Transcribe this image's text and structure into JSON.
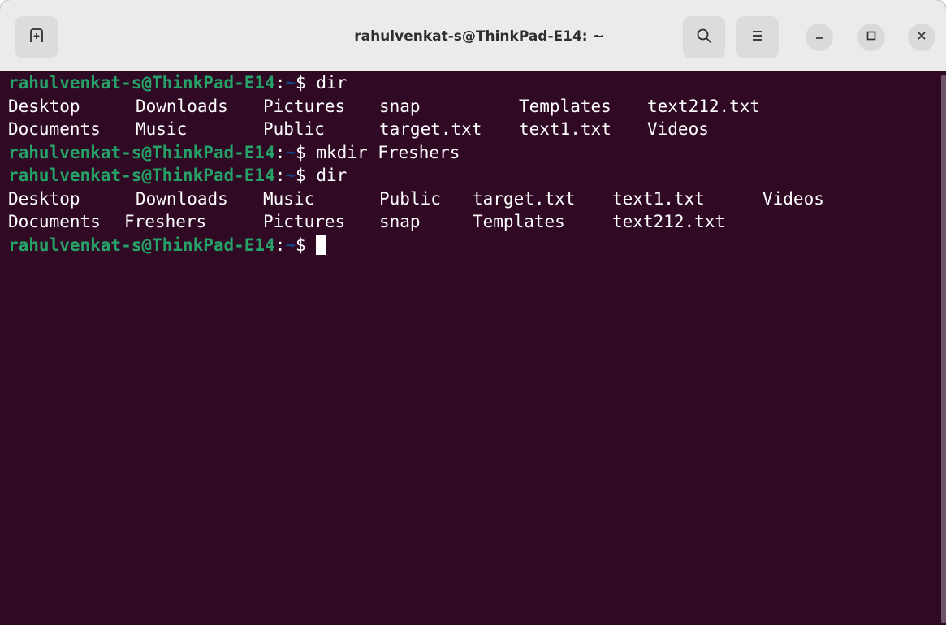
{
  "window": {
    "title": "rahulvenkat-s@ThinkPad-E14: ~"
  },
  "icons": {
    "new_tab": "new-tab-icon",
    "search": "search-icon",
    "menu": "hamburger-menu-icon",
    "minimize": "minimize-icon",
    "maximize": "maximize-icon",
    "close": "close-icon"
  },
  "colors": {
    "terminal_bg": "#300a24",
    "prompt_user": "#26a269",
    "prompt_path": "#12488b",
    "text": "#ffffff",
    "headerbar": "#ebebeb"
  },
  "prompt": {
    "user": "rahulvenkat-s@ThinkPad-E14",
    "separator": ":",
    "path": "~",
    "symbol": "$ "
  },
  "terminal": {
    "lines": [
      {
        "type": "prompt",
        "command": "dir"
      },
      {
        "type": "output",
        "cells": [
          "Desktop",
          "Downloads",
          "Pictures",
          "snap",
          "Templates",
          "text212.txt"
        ]
      },
      {
        "type": "output",
        "cells": [
          "Documents",
          "Music",
          "Public",
          "target.txt",
          "text1.txt",
          "Videos"
        ]
      },
      {
        "type": "prompt",
        "command": "mkdir Freshers"
      },
      {
        "type": "prompt",
        "command": "dir"
      },
      {
        "type": "output",
        "cells": [
          "Desktop",
          "Downloads",
          "Music",
          "Public",
          "target.txt",
          "text1.txt",
          "Videos"
        ]
      },
      {
        "type": "output",
        "cells": [
          "Documents",
          "Freshers",
          "Pictures",
          "snap",
          "Templates",
          "text212.txt"
        ]
      },
      {
        "type": "prompt",
        "command": "",
        "cursor": true
      }
    ]
  }
}
